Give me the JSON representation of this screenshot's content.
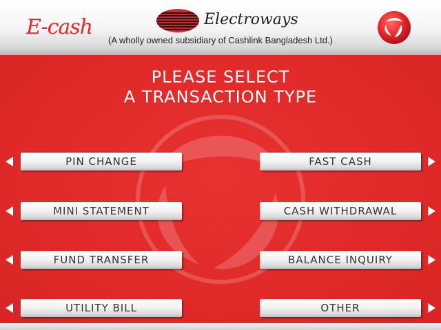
{
  "header": {
    "brand_left": "E-cash",
    "company_name": "Electroways",
    "subsidiary_text": "(A wholly owned subsidiary of Cashlink Bangladesh Ltd.)"
  },
  "screen": {
    "title_line1": "PLEASE SELECT",
    "title_line2": "A TRANSACTION TYPE"
  },
  "left_options": [
    {
      "label": "PIN CHANGE"
    },
    {
      "label": "MINI STATEMENT"
    },
    {
      "label": "FUND TRANSFER"
    },
    {
      "label": "UTILITY BILL"
    }
  ],
  "right_options": [
    {
      "label": "FAST CASH"
    },
    {
      "label": "CASH WITHDRAWAL"
    },
    {
      "label": "BALANCE INQUIRY"
    },
    {
      "label": "OTHER"
    }
  ],
  "colors": {
    "background_red": "#e02a2a",
    "brand_red": "#e8262b",
    "button_text": "#333333"
  },
  "icons": {
    "left_arrow": "triangle-left",
    "right_arrow": "triangle-right"
  }
}
